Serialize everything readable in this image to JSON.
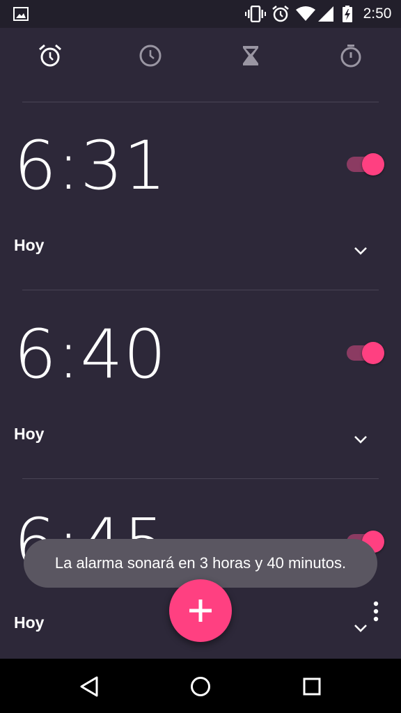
{
  "statusbar": {
    "time": "2:50",
    "icons": [
      "image-notification-icon",
      "vibrate-icon",
      "alarm-clock-icon",
      "wifi-icon",
      "signal-icon",
      "battery-charging-icon"
    ]
  },
  "tabs": [
    {
      "name": "alarm",
      "icon": "alarm-clock-icon",
      "active": true
    },
    {
      "name": "clock",
      "icon": "clock-icon",
      "active": false
    },
    {
      "name": "timer",
      "icon": "hourglass-icon",
      "active": false
    },
    {
      "name": "stopwatch",
      "icon": "stopwatch-icon",
      "active": false
    }
  ],
  "alarms": [
    {
      "time": "6:31",
      "day": "Hoy",
      "enabled": true
    },
    {
      "time": "6:40",
      "day": "Hoy",
      "enabled": true
    },
    {
      "time": "6:45",
      "day": "Hoy",
      "enabled": true
    }
  ],
  "toast": {
    "text": "La alarma sonará en 3 horas y 40 minutos."
  },
  "fab": {
    "icon": "plus-icon"
  },
  "colors": {
    "background": "#2d2839",
    "accent": "#ff4081",
    "statusbar": "#221f2b"
  },
  "navbar": {
    "buttons": [
      "back-icon",
      "home-icon",
      "recents-icon"
    ]
  }
}
